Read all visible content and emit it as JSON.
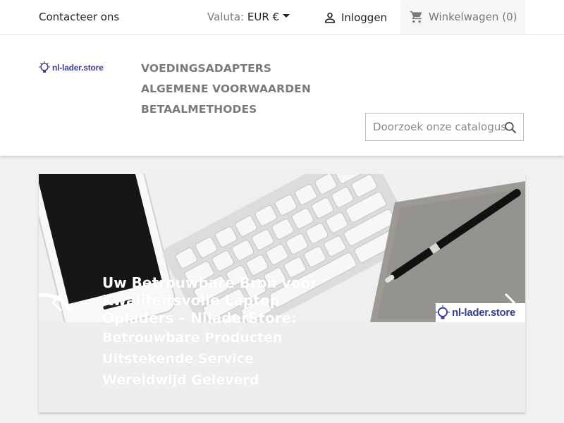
{
  "topbar": {
    "contact": "Contacteer ons",
    "currency_label": "Valuta:",
    "currency_value": "EUR €",
    "login": "Inloggen",
    "cart": "Winkelwagen",
    "cart_count": "(0)"
  },
  "header": {
    "logo_text": "nl-lader.store",
    "nav": [
      "VOEDINGSADAPTERS",
      "ALGEMENE VOORWAARDEN",
      "BETAALMETHODES"
    ],
    "search_placeholder": "Doorzoek onze catalogus"
  },
  "slider": {
    "title": "Uw Betrouwbare Bron voor Kwaliteitsvolle Laptop Opladers – NlladerStore:",
    "lines": [
      "Betrouwbare Producten",
      "Uitstekende Service",
      "Wereldwijd Geleverd"
    ],
    "watermark": "nl-lader.store"
  },
  "colors": {
    "brand": "#3a3e8c",
    "nav": "#7a7a7a",
    "background": "#f1f1f1"
  },
  "icons": [
    "person-icon",
    "cart-icon",
    "search-icon",
    "chevron-left-icon",
    "chevron-right-icon",
    "lightbulb-logo-icon"
  ]
}
